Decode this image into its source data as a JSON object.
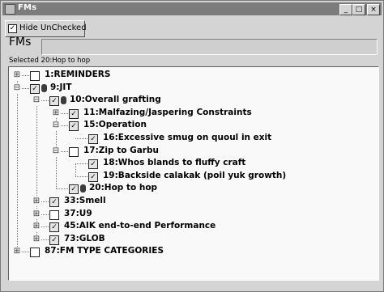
{
  "window": {
    "title": "FMs"
  },
  "title_buttons": {
    "minimize": "_",
    "maximize": "□",
    "close": "×"
  },
  "toolbar": {
    "hide_unchecked_label": "Hide UnChecked"
  },
  "header": {
    "label": "FMs",
    "field_value": ""
  },
  "status": {
    "selected_text": "Selected 20:Hop to hop"
  },
  "glyphs": {
    "expanded": "⊟",
    "collapsed": "⊞",
    "check": "✓"
  },
  "tree": [
    {
      "label": "1:REMINDERS",
      "state": "unchecked",
      "expander": "collapsed",
      "icon": "none"
    },
    {
      "label": "9:JIT",
      "state": "checked",
      "expander": "expanded",
      "icon": "fm-node-icon"
    },
    {
      "label": "10:Overall grafting",
      "state": "checked",
      "expander": "expanded",
      "icon": "fm-node-icon"
    },
    {
      "label": "11:Malfazing/Jaspering Constraints",
      "state": "checked",
      "expander": "collapsed",
      "icon": "none"
    },
    {
      "label": "15:Operation",
      "state": "checked",
      "expander": "expanded",
      "icon": "none"
    },
    {
      "label": "16:Excessive smug on quoul in exit",
      "state": "checked",
      "expander": "none",
      "icon": "none"
    },
    {
      "label": "17:Zip to Garbu",
      "state": "unchecked",
      "expander": "expanded",
      "icon": "none"
    },
    {
      "label": "18:Whos blands to fluffy craft",
      "state": "checked",
      "expander": "none",
      "icon": "none"
    },
    {
      "label": "19:Backside calakak (poil yuk growth)",
      "state": "checked",
      "expander": "none",
      "icon": "none"
    },
    {
      "label": "20:Hop to hop",
      "state": "checked",
      "expander": "none",
      "icon": "fm-node-icon"
    },
    {
      "label": "33:Smell",
      "state": "checked",
      "expander": "collapsed",
      "icon": "none"
    },
    {
      "label": "37:U9",
      "state": "unchecked",
      "expander": "collapsed",
      "icon": "none"
    },
    {
      "label": "45:AIK end-to-end Performance",
      "state": "checked",
      "expander": "collapsed",
      "icon": "none"
    },
    {
      "label": "73:GLOB",
      "state": "checked",
      "expander": "collapsed",
      "icon": "none"
    },
    {
      "label": "87:FM TYPE CATEGORIES",
      "state": "unchecked",
      "expander": "collapsed",
      "icon": "none"
    }
  ]
}
